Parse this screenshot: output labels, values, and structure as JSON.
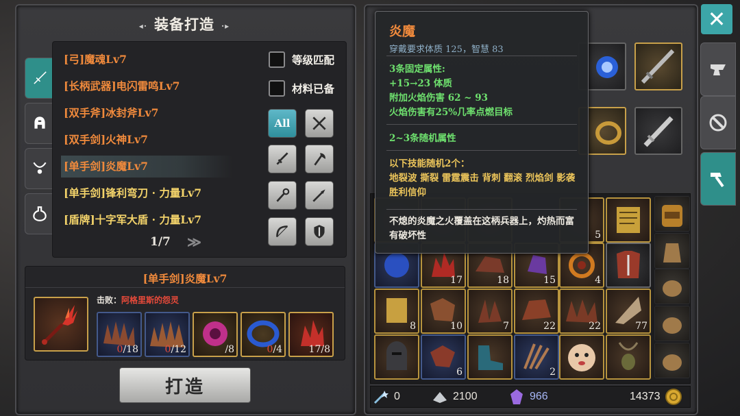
{
  "panel_title": "装备打造",
  "recipes": [
    {
      "label": "[弓]魔魂Lv7",
      "color": "orange"
    },
    {
      "label": "[长柄武器]电闪雷鸣Lv7",
      "color": "orange"
    },
    {
      "label": "[双手斧]冰封斧Lv7",
      "color": "orange"
    },
    {
      "label": "[双手剑]火神Lv7",
      "color": "orange"
    },
    {
      "label": "[单手剑]炎魔Lv7",
      "color": "orange",
      "selected": true
    },
    {
      "label": "[单手剑]锋利弯刀 · 力量Lv7",
      "color": "yellow"
    },
    {
      "label": "[盾牌]十字军大盾 · 力量Lv7",
      "color": "yellow"
    }
  ],
  "filters": {
    "level_match": "等级匹配",
    "materials_ready": "材料已备",
    "all_label": "All"
  },
  "pager": {
    "text": "1/7",
    "next": "≫"
  },
  "detail": {
    "title": "[单手剑]炎魔Lv7",
    "defeat_label": "击败：",
    "defeat_target": "阿格里斯的怨灵",
    "materials": [
      {
        "have": "0",
        "need": "/18",
        "lack": true
      },
      {
        "have": "0",
        "need": "/12",
        "lack": true
      },
      {
        "have": "",
        "need": "/8",
        "lack": true
      },
      {
        "have": "0",
        "need": "/4",
        "lack": true
      },
      {
        "have": "17",
        "need": "/8",
        "lack": false
      }
    ]
  },
  "craft_button": "打造",
  "tooltip": {
    "name": "炎魔",
    "requirement": "穿戴要求体质 125，智慧 83",
    "fixed_header": "3条固定属性:",
    "fixed_1": "+15→23 体质",
    "fixed_2": "附加火焰伤害 62 ~ 93",
    "fixed_3": "火焰伤害有25%几率点燃目标",
    "random_header": "2~3条随机属性",
    "skills": "以下技能随机2个：\n地裂波 撕裂 雷霆震击 背刺 翻滚 烈焰剑 影袭 胜利信仰",
    "flavor": "不熄的炎魔之火覆盖在这柄兵器上，灼热而富有破坏性"
  },
  "inventory_counts": {
    "row1": [
      "",
      "",
      "",
      "5"
    ],
    "row2": [
      "",
      "17",
      "18",
      "15",
      "4",
      ""
    ],
    "row3": [
      "8",
      "10",
      "7",
      "22",
      "22",
      "77"
    ],
    "row4": [
      "",
      "6",
      "",
      "2",
      "",
      ""
    ]
  },
  "currency": {
    "skill_points": "0",
    "silver": "2100",
    "crystal": "966",
    "gold": "14373"
  },
  "colors": {
    "accent": "#2f8f8a",
    "orange": "#f08a3c",
    "green": "#6ee06e",
    "skill": "#ebc45a"
  }
}
